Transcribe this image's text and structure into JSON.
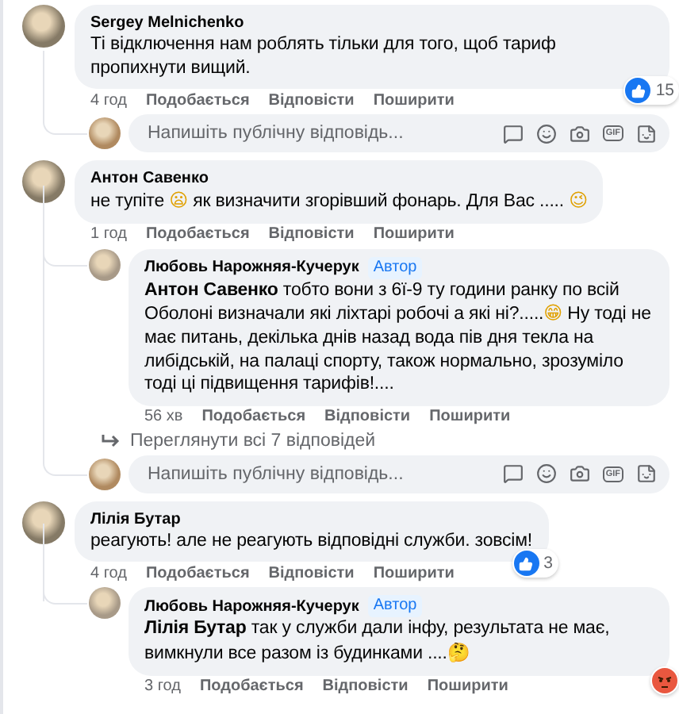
{
  "comments": [
    {
      "author": "Sergey Melnichenko",
      "text": "Ті відключення нам роблять тільки для того, щоб тариф пропихнути вищий.",
      "time": "4 год",
      "actions": [
        "Подобається",
        "Відповісти",
        "Поширити"
      ],
      "reaction": {
        "kind": "like",
        "count": "15"
      },
      "reply_box": {
        "placeholder": "Напишіть публічну відповідь...",
        "gif": "GIF"
      }
    },
    {
      "author": "Антон Савенко",
      "text": "не тупіте 😦 як визначити згорівший фонарь. Для Вас ..... 😉",
      "time": "1 год",
      "actions": [
        "Подобається",
        "Відповісти",
        "Поширити"
      ],
      "replies": [
        {
          "author": "Любовь Нарожняя-Кучерук",
          "badge": "Автор",
          "text": "**Антон Савенко** тобто вони з 6ї-9 ту години ранку по всій Оболоні визначали які ліхтарі робочі а які ні?.....😁 Ну тоді не має питань, декілька днів назад вода пів дня текла на либідській, на палаці спорту, також нормально, зрозуміло тоді ці підвищення тарифів!....",
          "time": "56 хв",
          "actions": [
            "Подобається",
            "Відповісти",
            "Поширити"
          ]
        }
      ],
      "more_replies": "Переглянути всі 7 відповідей",
      "reply_box": {
        "placeholder": "Напишіть публічну відповідь...",
        "gif": "GIF"
      }
    },
    {
      "author": "Лілія Бутар",
      "text": "реагують! але не реагують відповідні служби. зовсім!",
      "time": "4 год",
      "actions": [
        "Подобається",
        "Відповісти",
        "Поширити"
      ],
      "reaction": {
        "kind": "like",
        "count": "3"
      },
      "replies": [
        {
          "author": "Любовь Нарожняя-Кучерук",
          "badge": "Автор",
          "text": "**Лілія Бутар** так у служби дали інфу, результата не має, вимкнули все разом із будинками ....🤔",
          "time": "3 год",
          "actions": [
            "Подобається",
            "Відповісти",
            "Поширити"
          ],
          "reaction": {
            "kind": "angry"
          }
        }
      ]
    }
  ]
}
